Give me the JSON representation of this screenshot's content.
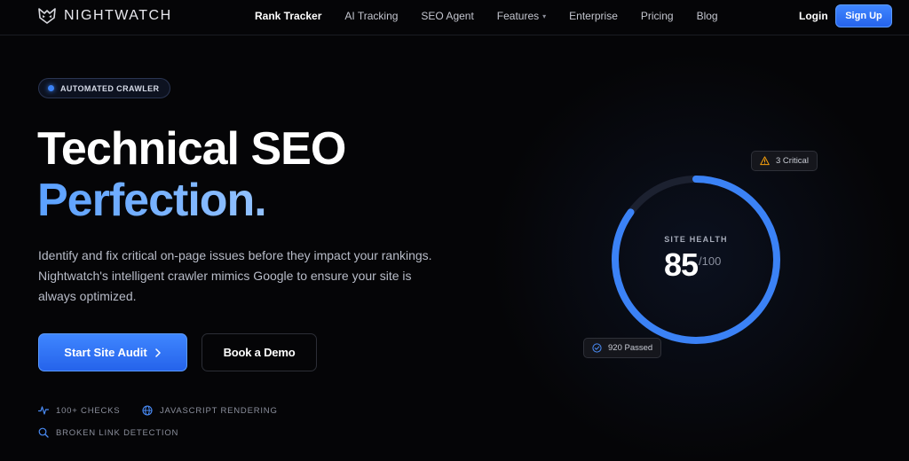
{
  "nav": {
    "brand": "NIGHTWATCH",
    "links": [
      "Rank Tracker",
      "AI Tracking",
      "SEO Agent",
      "Features",
      "Enterprise",
      "Pricing",
      "Blog"
    ],
    "login": "Login",
    "signup": "Sign Up"
  },
  "hero": {
    "badge": "AUTOMATED CRAWLER",
    "title_line1": "Technical SEO",
    "title_line2": "Perfection.",
    "lead": "Identify and fix critical on-page issues before they impact your rankings. Nightwatch's intelligent crawler mimics Google to ensure your site is always optimized.",
    "primary_button": "Start Site Audit",
    "secondary_button": "Book a Demo",
    "features": [
      "100+ CHECKS",
      "JAVASCRIPT RENDERING",
      "BROKEN LINK DETECTION"
    ]
  },
  "gauge": {
    "label": "SITE HEALTH",
    "value": "85",
    "max": "/100",
    "fraction": 0.85,
    "critical": "3 Critical",
    "passed": "920 Passed"
  },
  "colors": {
    "accent": "#3b82f6",
    "accent_light": "#93c2ff",
    "background": "#050507",
    "warning": "#f59e0b"
  },
  "icons": {
    "brand": "owl-logo-icon",
    "chevron": "chevron-down-icon",
    "arrow": "chevron-right-icon",
    "checks": "activity-pulse-icon",
    "javascript": "globe-icon",
    "links": "search-icon",
    "critical": "warning-triangle-icon",
    "passed": "check-circle-icon"
  }
}
